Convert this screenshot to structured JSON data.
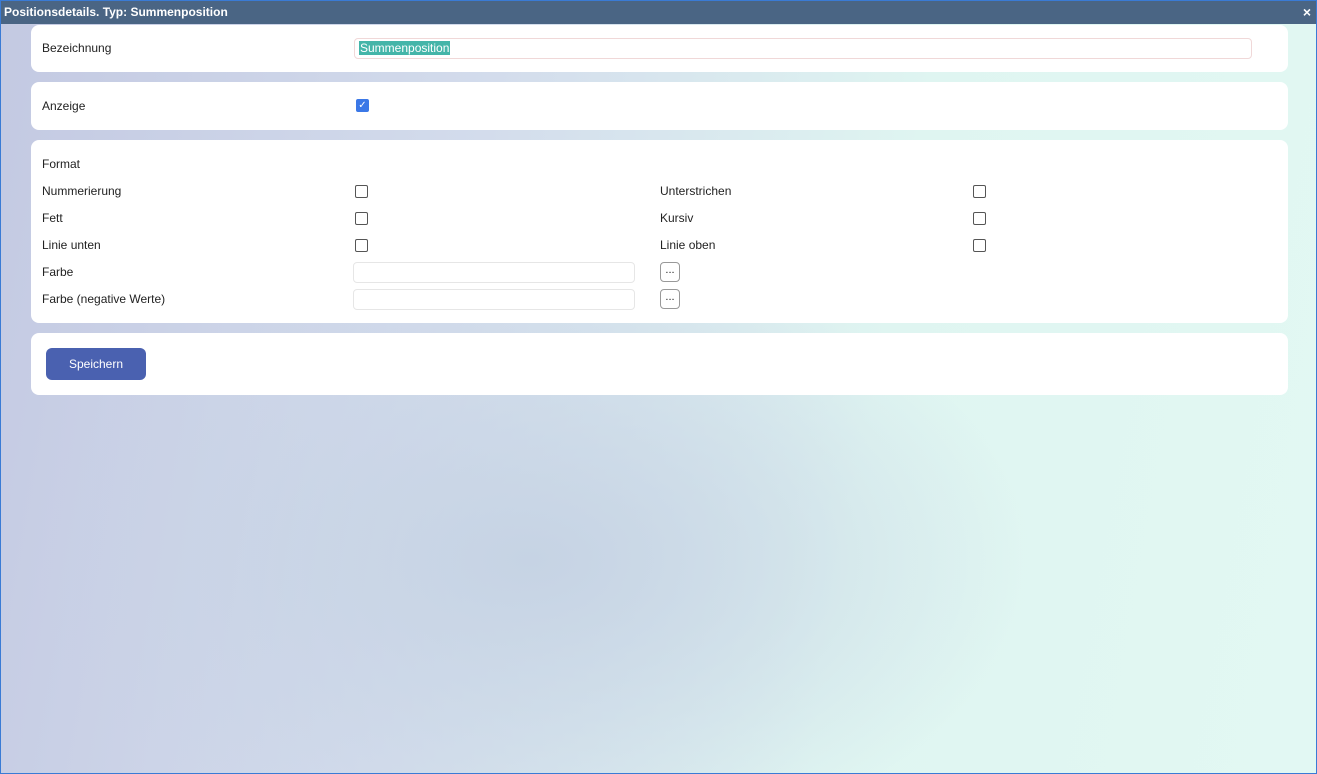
{
  "window": {
    "title": "Positionsdetails. Typ: Summenposition",
    "close_icon": "×"
  },
  "name": {
    "label": "Bezeichnung",
    "value": "Summenposition"
  },
  "display": {
    "label": "Anzeige",
    "checked": true
  },
  "format": {
    "heading": "Format",
    "numbering": {
      "label": "Nummerierung",
      "checked": false
    },
    "underline": {
      "label": "Unterstrichen",
      "checked": false
    },
    "bold": {
      "label": "Fett",
      "checked": false
    },
    "italic": {
      "label": "Kursiv",
      "checked": false
    },
    "line_below": {
      "label": "Linie unten",
      "checked": false
    },
    "line_above": {
      "label": "Linie oben",
      "checked": false
    },
    "color": {
      "label": "Farbe",
      "value": "",
      "button": "..."
    },
    "color_negative": {
      "label": "Farbe (negative Werte)",
      "value": "",
      "button": "..."
    }
  },
  "save_label": "Speichern"
}
